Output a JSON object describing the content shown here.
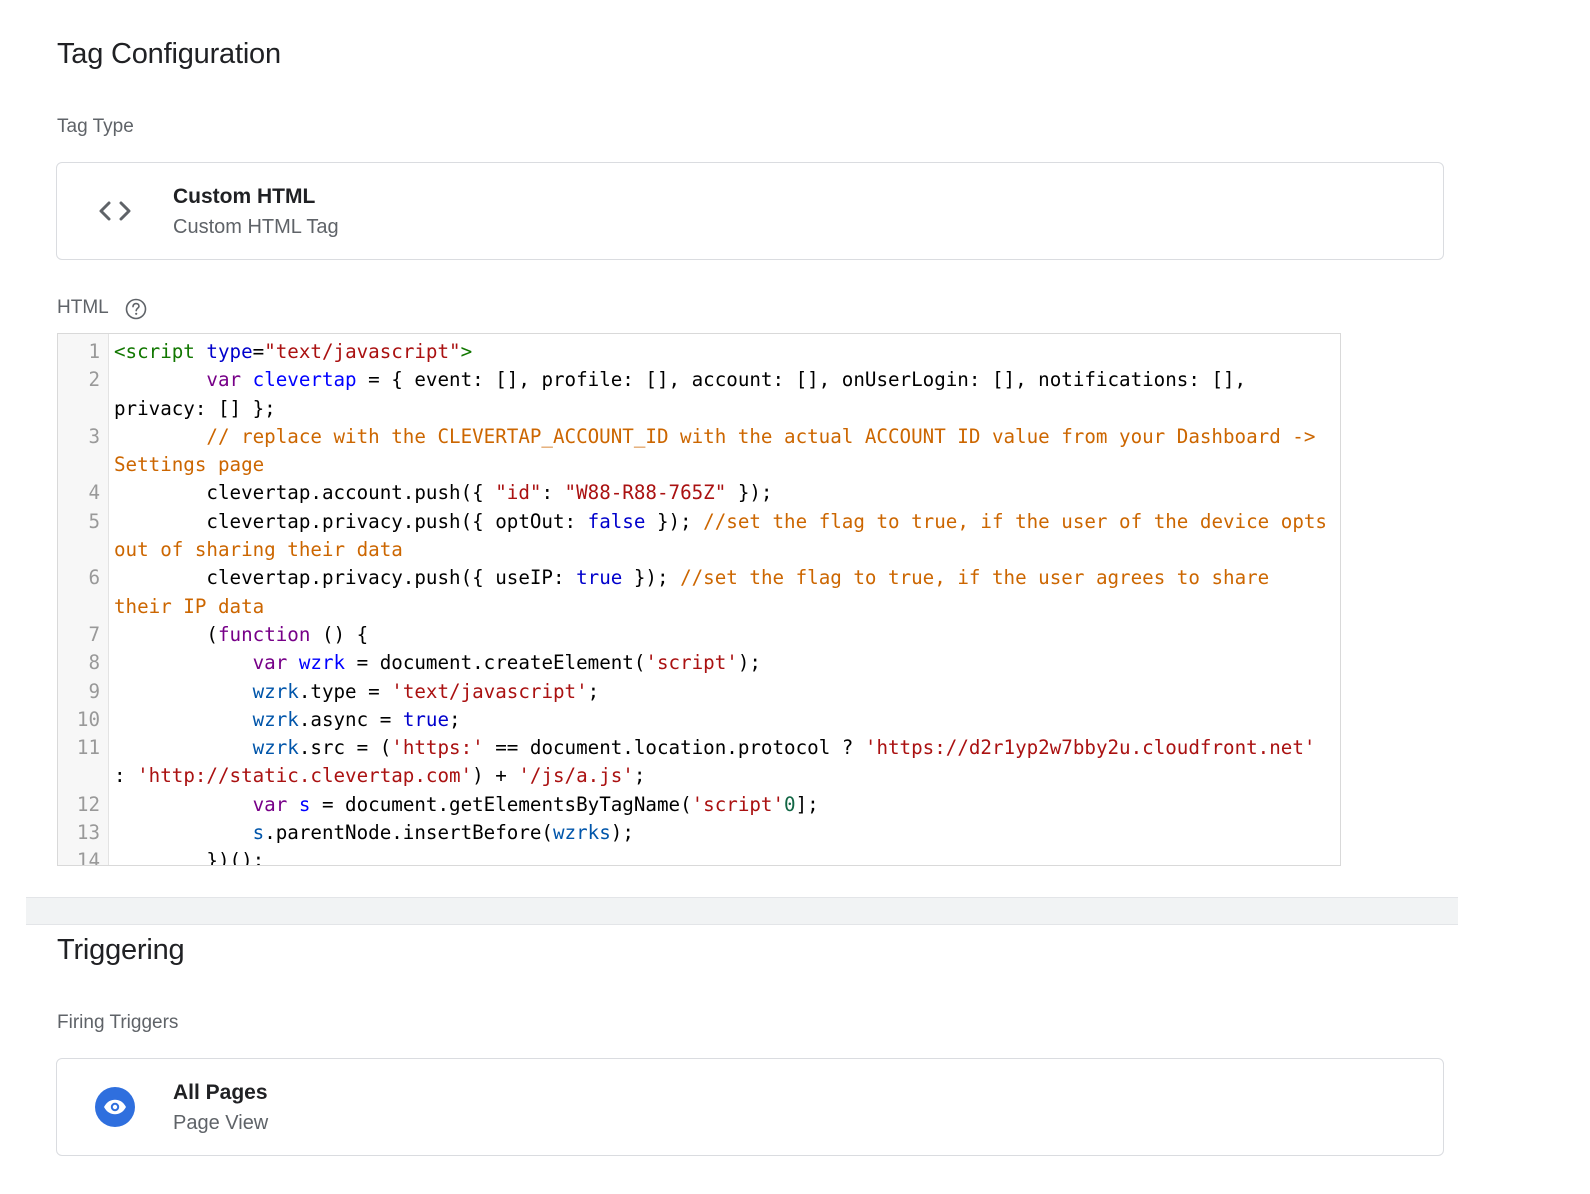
{
  "tag_configuration": {
    "title": "Tag Configuration",
    "tag_type_label": "Tag Type",
    "tag_type": {
      "name": "Custom HTML",
      "description": "Custom HTML Tag",
      "icon": "code-brackets-icon"
    },
    "html_label": "HTML",
    "help_icon": "help-circle-icon"
  },
  "code_lines": [
    {
      "n": "1",
      "t": [
        [
          "tg",
          "<script "
        ],
        [
          "at",
          "type"
        ],
        [
          "",
          "="
        ],
        [
          "st",
          "\"text/javascript\""
        ],
        [
          "tg",
          ">"
        ]
      ]
    },
    {
      "n": "2",
      "t": [
        [
          "",
          "        "
        ],
        [
          "kw",
          "var "
        ],
        [
          "df",
          "clevertap"
        ],
        [
          "",
          " = { event: [], profile: [], account: [], onUserLogin: [], notifications: [], privacy: [] };"
        ]
      ]
    },
    {
      "n": "3",
      "t": [
        [
          "",
          "        "
        ],
        [
          "cm",
          "// replace with the CLEVERTAP_ACCOUNT_ID with the actual ACCOUNT ID value from your Dashboard -> Settings page"
        ]
      ]
    },
    {
      "n": "4",
      "t": [
        [
          "",
          "        clevertap.account.push({ "
        ],
        [
          "st",
          "\"id\""
        ],
        [
          "",
          ": "
        ],
        [
          "st",
          "\"W88-R88-765Z\""
        ],
        [
          "",
          " });"
        ]
      ]
    },
    {
      "n": "5",
      "t": [
        [
          "",
          "        clevertap.privacy.push({ optOut: "
        ],
        [
          "at",
          "false"
        ],
        [
          "",
          " }); "
        ],
        [
          "cm",
          "//set the flag to true, if the user of the device opts out of sharing their data"
        ]
      ]
    },
    {
      "n": "6",
      "t": [
        [
          "",
          "        clevertap.privacy.push({ useIP: "
        ],
        [
          "at",
          "true"
        ],
        [
          "",
          " }); "
        ],
        [
          "cm",
          "//set the flag to true, if the user agrees to share their IP data"
        ]
      ]
    },
    {
      "n": "7",
      "t": [
        [
          "",
          "        ("
        ],
        [
          "kw",
          "function"
        ],
        [
          "",
          " () {"
        ]
      ]
    },
    {
      "n": "8",
      "t": [
        [
          "",
          "            "
        ],
        [
          "kw",
          "var "
        ],
        [
          "df",
          "wzrk"
        ],
        [
          "",
          " = document.createElement("
        ],
        [
          "st",
          "'script'"
        ],
        [
          "",
          ");"
        ]
      ]
    },
    {
      "n": "9",
      "t": [
        [
          "",
          "            "
        ],
        [
          "v2",
          "wzrk"
        ],
        [
          "",
          ".type = "
        ],
        [
          "st",
          "'text/javascript'"
        ],
        [
          "",
          ";"
        ]
      ]
    },
    {
      "n": "10",
      "t": [
        [
          "",
          "            "
        ],
        [
          "v2",
          "wzrk"
        ],
        [
          "",
          ".async = "
        ],
        [
          "at",
          "true"
        ],
        [
          "",
          ";"
        ]
      ]
    },
    {
      "n": "11",
      "t": [
        [
          "",
          "            "
        ],
        [
          "v2",
          "wzrk"
        ],
        [
          "",
          ".src = ("
        ],
        [
          "st",
          "'https:'"
        ],
        [
          "",
          " == document.location.protocol ? "
        ],
        [
          "st",
          "'https://d2r1yp2w7bby2u.cloudfront.net'"
        ],
        [
          "",
          " : "
        ],
        [
          "st",
          "'http://static.clevertap.com'"
        ],
        [
          "",
          ") + "
        ],
        [
          "st",
          "'/js/a.js'"
        ],
        [
          "",
          ";"
        ]
      ]
    },
    {
      "n": "12",
      "t": [
        [
          "",
          "            "
        ],
        [
          "kw",
          "var "
        ],
        [
          "df",
          "s"
        ],
        [
          "",
          " = document.getElementsByTagName("
        ],
        [
          "st",
          "'script'"
        ],
        [
          ")["
        ],
        [
          "nu",
          "0"
        ],
        [
          "",
          "];"
        ]
      ]
    },
    {
      "n": "13",
      "t": [
        [
          "",
          "            "
        ],
        [
          "v2",
          "s"
        ],
        [
          "",
          ".parentNode.insertBefore("
        ],
        [
          "v2",
          "wzrk"
        ],
        [
          ", "
        ],
        [
          "v2",
          "s"
        ],
        [
          "",
          ");"
        ]
      ]
    },
    {
      "n": "14",
      "t": [
        [
          "",
          "        })();"
        ]
      ]
    }
  ],
  "triggering": {
    "title": "Triggering",
    "firing_triggers_label": "Firing Triggers",
    "trigger": {
      "name": "All Pages",
      "description": "Page View",
      "icon": "eye-icon",
      "icon_color": "#2f6fde"
    }
  }
}
